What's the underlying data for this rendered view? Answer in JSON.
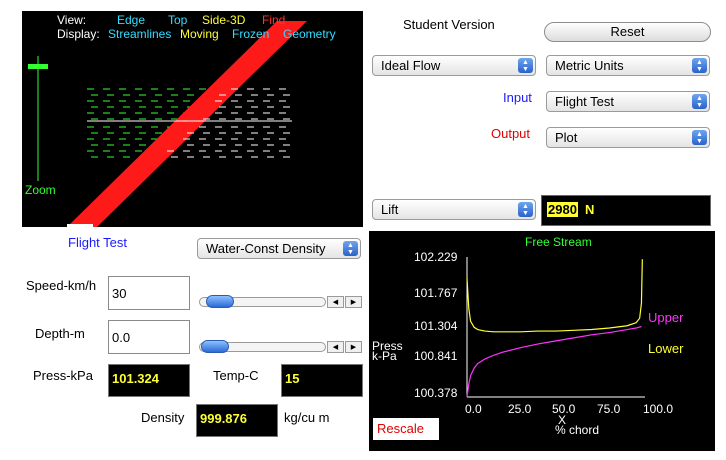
{
  "view": {
    "view_label": "View:",
    "edge": "Edge",
    "top": "Top",
    "side3d": "Side-3D",
    "find": "Find",
    "display_label": "Display:",
    "streamlines": "Streamlines",
    "moving": "Moving",
    "frozen": "Frozen",
    "geometry": "Geometry",
    "zoom": "Zoom"
  },
  "header": {
    "student_version": "Student Version",
    "reset": "Reset"
  },
  "controls": {
    "flow_select": "Ideal Flow",
    "units_select": "Metric Units",
    "input_label": "Input",
    "input_select": "Flight Test",
    "output_label": "Output",
    "output_select": "Plot",
    "result_select": "Lift",
    "result_value": "2980",
    "result_unit": "N"
  },
  "flight": {
    "title": "Flight Test",
    "fluid_select": "Water-Const Density",
    "speed_label": "Speed-km/h",
    "speed_value": "30",
    "depth_label": "Depth-m",
    "depth_value": "0.0",
    "press_label": "Press-kPa",
    "press_value": "101.324",
    "temp_label": "Temp-C",
    "temp_value": "15",
    "density_label": "Density",
    "density_value": "999.876",
    "density_unit": "kg/cu m",
    "speed_slider": 0.05,
    "depth_slider": 0.0
  },
  "chart_data": {
    "type": "line",
    "title": "Free Stream",
    "ylabel_line1": "Press",
    "ylabel_line2": "k-Pa",
    "xlabel_line1": "X",
    "xlabel_line2": "% chord",
    "xlim": [
      0,
      100
    ],
    "ylim": [
      100.378,
      102.229
    ],
    "x_ticks": [
      "0.0",
      "25.0",
      "50.0",
      "75.0",
      "100.0"
    ],
    "y_ticks": [
      "102.229",
      "101.767",
      "101.304",
      "100.841",
      "100.378"
    ],
    "series": [
      {
        "name": "Upper",
        "color": "#ff33ff",
        "x": [
          0,
          1,
          2,
          4,
          6,
          10,
          15,
          20,
          30,
          40,
          50,
          60,
          70,
          80,
          90,
          95,
          98
        ],
        "y": [
          100.38,
          100.55,
          100.66,
          100.76,
          100.82,
          100.88,
          100.93,
          100.97,
          101.03,
          101.08,
          101.12,
          101.16,
          101.2,
          101.23,
          101.27,
          101.29,
          101.31
        ]
      },
      {
        "name": "Lower",
        "color": "#ffff33",
        "x": [
          0,
          1,
          2,
          4,
          6,
          10,
          15,
          20,
          30,
          40,
          50,
          60,
          70,
          80,
          90,
          95,
          97,
          98,
          98.5
        ],
        "y": [
          101.95,
          101.55,
          101.38,
          101.3,
          101.27,
          101.25,
          101.24,
          101.24,
          101.24,
          101.25,
          101.25,
          101.26,
          101.27,
          101.29,
          101.32,
          101.36,
          101.42,
          101.62,
          102.2
        ]
      }
    ],
    "rescale_label": "Rescale"
  }
}
